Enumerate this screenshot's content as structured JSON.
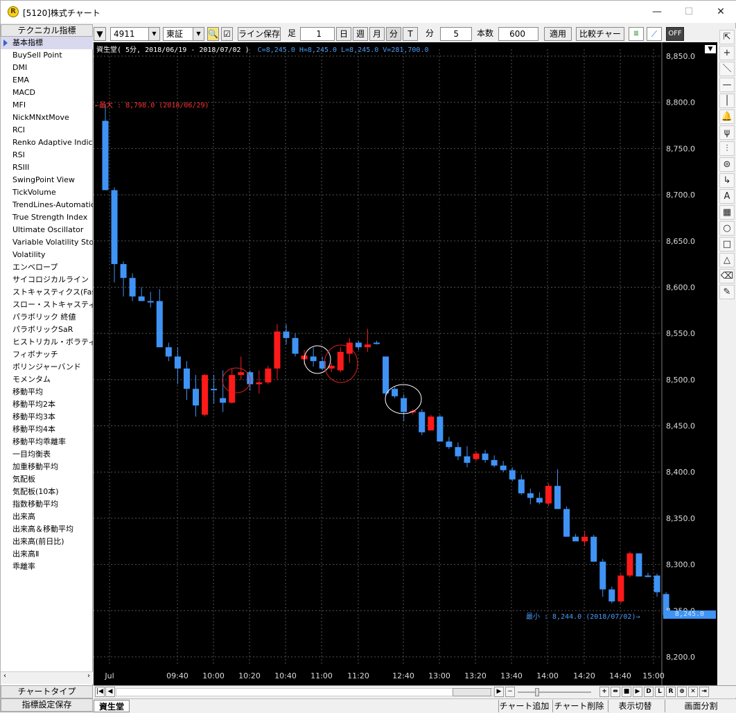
{
  "window": {
    "title": "[5120]株式チャート",
    "app_icon": "R"
  },
  "left_panel": {
    "header": "テクニカル指標",
    "items": [
      "基本指標",
      "BuySell Point",
      "DMI",
      "EMA",
      "MACD",
      "MFI",
      "NickMNxtMove",
      "RCI",
      "Renko Adaptive Indicator",
      "RSI",
      "RSIII",
      "SwingPoint View",
      "TickVolume",
      "TrendLines-Automatic",
      "True Strength Index",
      "Ultimate Oscillator",
      "Variable Volatility Stop",
      "Volatility",
      "エンベロープ",
      "サイコロジカルライン",
      "ストキャスティクス(Fast)",
      "スロー・ストキャスティクス",
      "パラボリック 終値",
      "パラボリックSaR",
      "ヒストリカル・ボラティリティ",
      "フィボナッチ",
      "ボリンジャーバンド",
      "モメンタム",
      "移動平均",
      "移動平均2本",
      "移動平均3本",
      "移動平均4本",
      "移動平均乖離率",
      "一目均衡表",
      "加重移動平均",
      "気配板",
      "気配板(10本)",
      "指数移動平均",
      "出来高",
      "出来高＆移動平均",
      "出来高(前日比)",
      "出来高Ⅱ",
      "乖離率"
    ],
    "chart_type_button": "チャートタイプ",
    "save_button": "指標設定保存"
  },
  "toolbar": {
    "code": "4911",
    "market": "東証",
    "line_save": "ライン保存",
    "ashi_label": "足",
    "ashi_value": "1",
    "day": "日",
    "week": "週",
    "month": "月",
    "minute": "分",
    "tick": "T",
    "minute_label": "分",
    "minute_value": "5",
    "count_label": "本数",
    "count_value": "600",
    "apply": "適用",
    "compare": "比較チャート",
    "off": "OFF"
  },
  "chart_info": {
    "header": "資生堂( 5分, 2018/06/19 - 2018/07/02 )",
    "ohlcv": "C=8,245.0 H=8,245.0 L=8,245.0 V=281,700.0",
    "max_label": "最大 : 8,798.0 (2018/06/29)",
    "min_label": "最小 : 8,244.0 (2018/07/02)",
    "current_price": "8,245.0"
  },
  "colors": {
    "up": "#ff1a1a",
    "down": "#3f93f5",
    "grid": "#555555",
    "axis_text": "#dcdcdc"
  },
  "chart_data": {
    "type": "candlestick",
    "title": "資生堂( 5分, 2018/06/19 - 2018/07/02 )",
    "xlabel": "",
    "ylabel": "",
    "x_ticks": [
      "Jul",
      "09:40",
      "10:00",
      "10:20",
      "10:40",
      "11:00",
      "11:20",
      "12:40",
      "13:00",
      "13:20",
      "13:40",
      "14:00",
      "14:20",
      "14:40",
      "15:00"
    ],
    "y_ticks": [
      "8,850.0",
      "8,800.0",
      "8,750.0",
      "8,700.0",
      "8,650.0",
      "8,600.0",
      "8,550.0",
      "8,500.0",
      "8,450.0",
      "8,400.0",
      "8,350.0",
      "8,300.0",
      "8,250.0",
      "8,200.0"
    ],
    "ylim": [
      8200,
      8850
    ],
    "grid": true,
    "candles": [
      [
        8780,
        8798,
        8705,
        8705
      ],
      [
        8705,
        8708,
        8605,
        8625
      ],
      [
        8625,
        8628,
        8590,
        8610
      ],
      [
        8610,
        8615,
        8585,
        8590
      ],
      [
        8590,
        8600,
        8585,
        8585
      ],
      [
        8585,
        8595,
        8578,
        8585
      ],
      [
        8585,
        8598,
        8535,
        8535
      ],
      [
        8535,
        8540,
        8520,
        8525
      ],
      [
        8525,
        8535,
        8495,
        8512
      ],
      [
        8512,
        8520,
        8478,
        8490
      ],
      [
        8490,
        8505,
        8460,
        8472
      ],
      [
        8462,
        8506,
        8460,
        8505
      ],
      [
        8490,
        8505,
        8474,
        8490
      ],
      [
        8480,
        8510,
        8465,
        8475
      ],
      [
        8475,
        8512,
        8474,
        8505
      ],
      [
        8505,
        8525,
        8500,
        8508
      ],
      [
        8508,
        8510,
        8488,
        8495
      ],
      [
        8495,
        8510,
        8485,
        8497
      ],
      [
        8497,
        8515,
        8495,
        8512
      ],
      [
        8512,
        8560,
        8500,
        8552
      ],
      [
        8552,
        8560,
        8538,
        8545
      ],
      [
        8545,
        8550,
        8525,
        8528
      ],
      [
        8522,
        8532,
        8516,
        8526
      ],
      [
        8525,
        8535,
        8514,
        8520
      ],
      [
        8520,
        8525,
        8510,
        8512
      ],
      [
        8512,
        8518,
        8508,
        8515
      ],
      [
        8510,
        8535,
        8508,
        8530
      ],
      [
        8528,
        8545,
        8518,
        8540
      ],
      [
        8540,
        8542,
        8532,
        8535
      ],
      [
        8535,
        8555,
        8530,
        8538
      ],
      [
        8540,
        8542,
        8538,
        8540
      ],
      [
        8525,
        8525,
        8482,
        8485
      ],
      [
        8490,
        8492,
        8480,
        8482
      ],
      [
        8480,
        8484,
        8455,
        8465
      ],
      [
        8465,
        8468,
        8462,
        8466
      ],
      [
        8465,
        8468,
        8440,
        8443
      ],
      [
        8445,
        8462,
        8445,
        8460
      ],
      [
        8460,
        8462,
        8433,
        8433
      ],
      [
        8433,
        8438,
        8425,
        8427
      ],
      [
        8427,
        8432,
        8413,
        8417
      ],
      [
        8417,
        8428,
        8405,
        8410
      ],
      [
        8414,
        8422,
        8412,
        8420
      ],
      [
        8420,
        8424,
        8410,
        8413
      ],
      [
        8413,
        8418,
        8405,
        8407
      ],
      [
        8407,
        8412,
        8400,
        8402
      ],
      [
        8402,
        8405,
        8390,
        8392
      ],
      [
        8392,
        8397,
        8375,
        8377
      ],
      [
        8377,
        8382,
        8365,
        8372
      ],
      [
        8372,
        8378,
        8365,
        8367
      ],
      [
        8366,
        8388,
        8363,
        8385
      ],
      [
        8385,
        8403,
        8360,
        8360
      ],
      [
        8360,
        8363,
        8330,
        8330
      ],
      [
        8330,
        8333,
        8325,
        8325
      ],
      [
        8325,
        8336,
        8320,
        8330
      ],
      [
        8330,
        8332,
        8303,
        8303
      ],
      [
        8303,
        8306,
        8265,
        8273
      ],
      [
        8273,
        8276,
        8258,
        8260
      ],
      [
        8260,
        8290,
        8258,
        8288
      ],
      [
        8288,
        8314,
        8286,
        8312
      ],
      [
        8312,
        8312,
        8287,
        8287
      ],
      [
        8288,
        8291,
        8286,
        8288
      ],
      [
        8288,
        8290,
        8265,
        8270
      ],
      [
        8268,
        8270,
        8244,
        8245
      ]
    ]
  },
  "right_tools": [
    "cursor-icon",
    "crosshair-icon",
    "trend-line-icon",
    "horizontal-line-icon",
    "vertical-line-icon",
    "alarm-icon",
    "fork-icon",
    "fibonacci-icon",
    "channel-icon",
    "arrow-icon",
    "text-icon",
    "grid-icon",
    "ellipse-icon",
    "rectangle-icon",
    "triangle-icon",
    "eraser-icon",
    "eraser-all-icon"
  ],
  "bottom_bar": {
    "nav_labels": [
      "+",
      "⇹",
      "■",
      "▶",
      "D",
      "L",
      "R",
      "⊕",
      "✕",
      "⇥"
    ]
  },
  "status_bar": {
    "symbol": "資生堂",
    "add_chart": "チャート追加",
    "delete_chart": "チャート削除",
    "toggle_display": "表示切替",
    "split_screen": "画面分割"
  }
}
